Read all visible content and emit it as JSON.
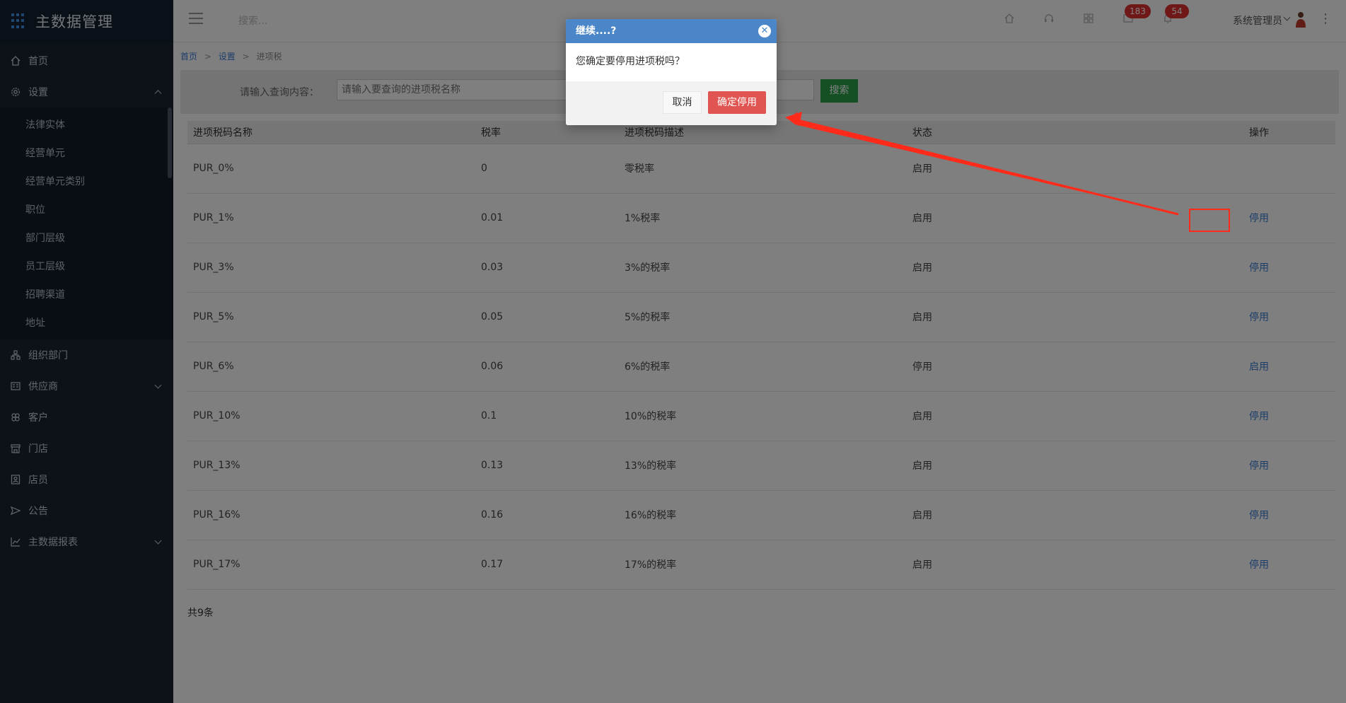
{
  "app": {
    "title": "主数据管理"
  },
  "sidebar": {
    "items": [
      {
        "label": "首页",
        "icon": "home-icon"
      },
      {
        "label": "设置",
        "icon": "gear-icon",
        "expanded": true
      },
      {
        "label": "组织部门",
        "icon": "org-icon"
      },
      {
        "label": "供应商",
        "icon": "supplier-icon",
        "has_children": true
      },
      {
        "label": "客户",
        "icon": "customer-icon"
      },
      {
        "label": "门店",
        "icon": "store-icon"
      },
      {
        "label": "店员",
        "icon": "clerk-icon"
      },
      {
        "label": "公告",
        "icon": "announce-icon"
      },
      {
        "label": "主数据报表",
        "icon": "chart-icon",
        "has_children": true
      }
    ],
    "settings_children": [
      "法律实体",
      "经营单元",
      "经营单元类别",
      "职位",
      "部门层级",
      "员工层级",
      "招聘渠道",
      "地址"
    ]
  },
  "topbar": {
    "search_placeholder": "搜索...",
    "badge_messages": "183",
    "badge_notifications": "54",
    "user_name": "系统管理员"
  },
  "breadcrumb": {
    "home": "首页",
    "settings": "设置",
    "current": "进项税"
  },
  "filter": {
    "label": "请输入查询内容：",
    "placeholder": "请输入要查询的进项税名称",
    "search_button": "搜索"
  },
  "table": {
    "headers": [
      "进项税码名称",
      "税率",
      "进项税码描述",
      "状态",
      "操作"
    ],
    "rows": [
      {
        "name": "PUR_0%",
        "rate": "0",
        "desc": "零税率",
        "status": "启用",
        "action": ""
      },
      {
        "name": "PUR_1%",
        "rate": "0.01",
        "desc": "1%税率",
        "status": "启用",
        "action": "停用"
      },
      {
        "name": "PUR_3%",
        "rate": "0.03",
        "desc": "3%的税率",
        "status": "启用",
        "action": "停用"
      },
      {
        "name": "PUR_5%",
        "rate": "0.05",
        "desc": "5%的税率",
        "status": "启用",
        "action": "停用"
      },
      {
        "name": "PUR_6%",
        "rate": "0.06",
        "desc": "6%的税率",
        "status": "停用",
        "action": "启用"
      },
      {
        "name": "PUR_10%",
        "rate": "0.1",
        "desc": "10%的税率",
        "status": "启用",
        "action": "停用"
      },
      {
        "name": "PUR_13%",
        "rate": "0.13",
        "desc": "13%的税率",
        "status": "启用",
        "action": "停用"
      },
      {
        "name": "PUR_16%",
        "rate": "0.16",
        "desc": "16%的税率",
        "status": "启用",
        "action": "停用"
      },
      {
        "name": "PUR_17%",
        "rate": "0.17",
        "desc": "17%的税率",
        "status": "启用",
        "action": "停用"
      }
    ],
    "total": "共9条"
  },
  "dialog": {
    "title": "继续....?",
    "message": "您确定要停用进项税吗？",
    "cancel": "取消",
    "confirm": "确定停用"
  },
  "colors": {
    "sidebar_bg": "#1a2433",
    "accent": "#3a7bd5",
    "search_btn": "#2aa048",
    "confirm_btn": "#e05552",
    "badge": "#e02f2f",
    "annotation": "#ff2a1a"
  }
}
